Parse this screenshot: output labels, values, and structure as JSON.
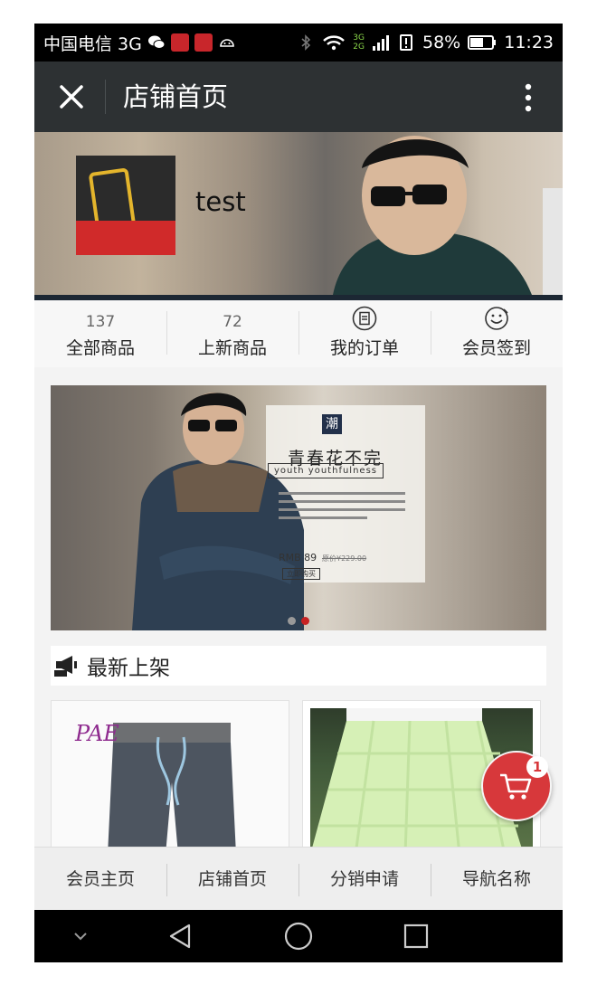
{
  "status_bar": {
    "carrier": "中国电信 3G",
    "signal_label_top": "3G",
    "signal_label_bottom": "2G",
    "battery": "58%",
    "time": "11:23"
  },
  "title_bar": {
    "title": "店铺首页"
  },
  "shop": {
    "name": "test"
  },
  "stats": [
    {
      "value": "137",
      "label": "全部商品"
    },
    {
      "value": "72",
      "label": "上新商品"
    },
    {
      "icon": "order-icon",
      "label": "我的订单"
    },
    {
      "icon": "smile-icon",
      "label": "会员签到"
    }
  ],
  "promo": {
    "brand": "潮",
    "title": "青春花不完",
    "subtitle": "youth youthfulness",
    "price": "RMB 89",
    "old_price": "原价¥229.00",
    "button": "立即购买",
    "active_slide": 2,
    "slide_count": 2
  },
  "section": {
    "title": "最新上架"
  },
  "products": [
    {
      "brand": "PAE"
    },
    {}
  ],
  "cart": {
    "count": "1",
    "accent": "#d7383b"
  },
  "tabs": [
    "会员主页",
    "店铺首页",
    "分销申请",
    "导航名称"
  ],
  "colors": {
    "title_bar": "#2d3133",
    "status_bar": "#000000",
    "active_dot": "#c72222"
  }
}
